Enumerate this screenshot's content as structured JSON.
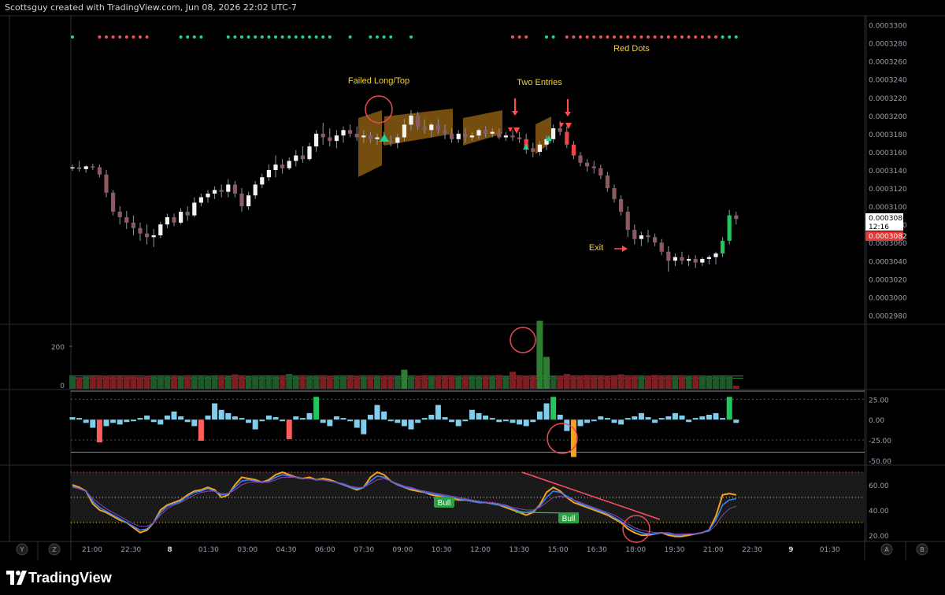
{
  "header": {
    "caption": "Scottsguy created with TradingView.com, Jun 08, 2026 22:02 UTC-7"
  },
  "footer": {
    "brand": "TradingView"
  },
  "annotations": {
    "failed_long": "Failed Long/Top",
    "two_entries": "Two Entries",
    "red_dots": "Red Dots",
    "exit": "Exit",
    "bull1": "Bull",
    "bull2": "Bull"
  },
  "price_scale": {
    "ticks": [
      "0.0003300",
      "0.0003280",
      "0.0003260",
      "0.0003240",
      "0.0003220",
      "0.0003200",
      "0.0003180",
      "0.0003160",
      "0.0003140",
      "0.0003120",
      "0.0003100",
      "0.0003080",
      "0.0003060",
      "0.0003040",
      "0.0003020",
      "0.0003000",
      "0.0002980"
    ],
    "last_price": "0.0003086",
    "countdown": "12:16",
    "other_price": "0.0003082"
  },
  "volume_scale": [
    "200",
    "0"
  ],
  "osc_scale": [
    "25.00",
    "0.00",
    "-25.00",
    "-50.00"
  ],
  "rsi_scale": [
    "60.00",
    "40.00",
    "20.00"
  ],
  "time_axis": [
    "21:00",
    "22:30",
    "8",
    "01:30",
    "03:00",
    "04:30",
    "06:00",
    "07:30",
    "09:00",
    "10:30",
    "12:00",
    "13:30",
    "15:00",
    "16:30",
    "18:00",
    "19:30",
    "21:00",
    "22:30",
    "9",
    "01:30"
  ],
  "axis_buttons": {
    "y": "Y",
    "z": "Z",
    "a1": "A",
    "b": "B",
    "a2": "A"
  },
  "colors": {
    "bull": "#22c55e",
    "bear": "#ef4444",
    "white": "#f4f4f4",
    "dull_red": "#8c5a60",
    "teal": "#26a69a",
    "signal_green": "#1ed39a",
    "signal_red": "#f0505a",
    "annotation": "#f6d232",
    "orange_zone": "#8a5a12",
    "hist_blue": "#80cdec",
    "vol_red": "#7d1e22",
    "vol_green": "#1f5a2a",
    "rsi_orange": "#f7a21b",
    "rsi_blue": "#3b82f6",
    "rsi_purple": "#8e44ad"
  },
  "chart_data": [
    {
      "type": "candlestick",
      "title": "",
      "ylim": [
        0.000297,
        0.000331
      ],
      "x_start": "Jun 07 20:00",
      "note_candles": "approximate OHLC read from the image",
      "candles": [
        [
          0.0003142,
          0.0003146,
          0.0003139,
          0.0003143
        ],
        [
          0.0003143,
          0.000315,
          0.0003138,
          0.0003141
        ],
        [
          0.0003141,
          0.0003145,
          0.0003137,
          0.0003144
        ],
        [
          0.0003144,
          0.0003147,
          0.000314,
          0.0003143
        ],
        [
          0.0003143,
          0.0003146,
          0.0003132,
          0.0003135
        ],
        [
          0.0003135,
          0.000314,
          0.000311,
          0.0003115
        ],
        [
          0.0003115,
          0.0003118,
          0.000309,
          0.0003094
        ],
        [
          0.0003094,
          0.00031,
          0.000308,
          0.0003088
        ],
        [
          0.0003088,
          0.0003095,
          0.0003075,
          0.0003082
        ],
        [
          0.0003082,
          0.000309,
          0.0003068,
          0.0003076
        ],
        [
          0.0003076,
          0.0003082,
          0.0003062,
          0.000307
        ],
        [
          0.000307,
          0.000308,
          0.0003058,
          0.0003066
        ],
        [
          0.0003066,
          0.0003075,
          0.0003055,
          0.0003068
        ],
        [
          0.0003068,
          0.0003083,
          0.0003065,
          0.000308
        ],
        [
          0.000308,
          0.0003092,
          0.0003076,
          0.0003088
        ],
        [
          0.0003088,
          0.0003092,
          0.0003078,
          0.0003082
        ],
        [
          0.0003082,
          0.0003098,
          0.000308,
          0.0003094
        ],
        [
          0.0003094,
          0.00031,
          0.0003084,
          0.000309
        ],
        [
          0.000309,
          0.000311,
          0.0003088,
          0.0003104
        ],
        [
          0.0003104,
          0.0003114,
          0.00031,
          0.000311
        ],
        [
          0.000311,
          0.0003118,
          0.0003104,
          0.0003114
        ],
        [
          0.0003114,
          0.0003122,
          0.0003108,
          0.0003118
        ],
        [
          0.0003118,
          0.0003124,
          0.000311,
          0.0003116
        ],
        [
          0.0003116,
          0.000313,
          0.000311,
          0.0003124
        ],
        [
          0.0003124,
          0.0003128,
          0.000311,
          0.0003114
        ],
        [
          0.0003114,
          0.000312,
          0.0003094,
          0.00031
        ],
        [
          0.00031,
          0.0003116,
          0.0003096,
          0.0003112
        ],
        [
          0.0003112,
          0.0003128,
          0.0003108,
          0.0003124
        ],
        [
          0.0003124,
          0.0003136,
          0.000312,
          0.0003132
        ],
        [
          0.0003132,
          0.0003146,
          0.0003128,
          0.000314
        ],
        [
          0.000314,
          0.0003156,
          0.0003132,
          0.0003146
        ],
        [
          0.0003146,
          0.0003152,
          0.0003136,
          0.0003142
        ],
        [
          0.0003142,
          0.0003154,
          0.000314,
          0.000315
        ],
        [
          0.000315,
          0.0003162,
          0.0003144,
          0.0003156
        ],
        [
          0.0003156,
          0.0003166,
          0.0003148,
          0.0003152
        ],
        [
          0.0003152,
          0.000317,
          0.000315,
          0.0003166
        ],
        [
          0.0003166,
          0.0003184,
          0.000316,
          0.000318
        ],
        [
          0.000318,
          0.0003192,
          0.0003168,
          0.0003176
        ],
        [
          0.0003176,
          0.0003186,
          0.0003166,
          0.0003172
        ],
        [
          0.0003172,
          0.0003184,
          0.0003164,
          0.0003178
        ],
        [
          0.0003178,
          0.0003188,
          0.000317,
          0.0003184
        ],
        [
          0.0003184,
          0.000319,
          0.0003176,
          0.000318
        ],
        [
          0.000318,
          0.0003188,
          0.0003172,
          0.0003176
        ],
        [
          0.0003176,
          0.0003184,
          0.000317,
          0.0003178
        ],
        [
          0.0003178,
          0.0003182,
          0.000317,
          0.0003174
        ],
        [
          0.0003174,
          0.000318,
          0.0003168,
          0.0003176
        ],
        [
          0.0003176,
          0.0003182,
          0.0003168,
          0.0003172
        ],
        [
          0.0003172,
          0.0003178,
          0.0003166,
          0.000317
        ],
        [
          0.000317,
          0.000318,
          0.0003164,
          0.0003176
        ],
        [
          0.0003176,
          0.0003196,
          0.0003172,
          0.000319
        ],
        [
          0.000319,
          0.0003206,
          0.0003184,
          0.00032
        ],
        [
          0.00032,
          0.0003204,
          0.0003184,
          0.0003188
        ],
        [
          0.0003188,
          0.0003196,
          0.000318,
          0.0003184
        ],
        [
          0.0003184,
          0.0003192,
          0.0003176,
          0.000319
        ],
        [
          0.000319,
          0.0003196,
          0.000318,
          0.0003184
        ],
        [
          0.0003184,
          0.000319,
          0.0003174,
          0.000318
        ],
        [
          0.000318,
          0.0003186,
          0.000317,
          0.0003174
        ],
        [
          0.0003174,
          0.0003184,
          0.000317,
          0.000318
        ],
        [
          0.000318,
          0.0003186,
          0.000317,
          0.0003176
        ],
        [
          0.0003176,
          0.0003182,
          0.0003172,
          0.0003178
        ],
        [
          0.0003178,
          0.0003186,
          0.0003174,
          0.0003184
        ],
        [
          0.0003184,
          0.0003188,
          0.0003176,
          0.000318
        ],
        [
          0.000318,
          0.0003186,
          0.0003176,
          0.0003182
        ],
        [
          0.0003182,
          0.0003186,
          0.0003174,
          0.0003176
        ],
        [
          0.0003176,
          0.0003182,
          0.0003172,
          0.0003178
        ],
        [
          0.0003178,
          0.0003184,
          0.0003172,
          0.0003176
        ],
        [
          0.0003176,
          0.0003182,
          0.000317,
          0.0003174
        ],
        [
          0.0003174,
          0.000318,
          0.0003158,
          0.0003164
        ],
        [
          0.0003164,
          0.000317,
          0.0003154,
          0.000316
        ],
        [
          0.000316,
          0.0003172,
          0.0003156,
          0.0003168
        ],
        [
          0.0003168,
          0.0003178,
          0.0003162,
          0.0003174
        ],
        [
          0.0003174,
          0.000319,
          0.000317,
          0.0003186
        ],
        [
          0.0003186,
          0.0003194,
          0.0003178,
          0.0003182
        ],
        [
          0.0003182,
          0.0003188,
          0.0003164,
          0.0003168
        ],
        [
          0.0003168,
          0.0003172,
          0.0003152,
          0.0003156
        ],
        [
          0.0003156,
          0.000316,
          0.0003144,
          0.0003148
        ],
        [
          0.0003148,
          0.0003152,
          0.0003138,
          0.0003144
        ],
        [
          0.0003144,
          0.000315,
          0.0003136,
          0.0003142
        ],
        [
          0.0003142,
          0.0003146,
          0.000313,
          0.0003134
        ],
        [
          0.0003134,
          0.0003138,
          0.0003116,
          0.000312
        ],
        [
          0.000312,
          0.0003124,
          0.0003104,
          0.0003108
        ],
        [
          0.0003108,
          0.0003112,
          0.000309,
          0.0003094
        ],
        [
          0.0003094,
          0.00031,
          0.0003066,
          0.0003074
        ],
        [
          0.0003074,
          0.000308,
          0.0003058,
          0.0003064
        ],
        [
          0.0003064,
          0.0003072,
          0.0003056,
          0.0003068
        ],
        [
          0.0003068,
          0.0003074,
          0.000306,
          0.0003066
        ],
        [
          0.0003066,
          0.000307,
          0.0003056,
          0.000306
        ],
        [
          0.000306,
          0.0003064,
          0.0003046,
          0.000305
        ],
        [
          0.000305,
          0.0003056,
          0.0003028,
          0.000304
        ],
        [
          0.000304,
          0.0003048,
          0.0003034,
          0.0003044
        ],
        [
          0.0003044,
          0.000305,
          0.0003036,
          0.000304
        ],
        [
          0.000304,
          0.0003046,
          0.0003034,
          0.0003042
        ],
        [
          0.0003042,
          0.0003046,
          0.0003032,
          0.0003038
        ],
        [
          0.0003038,
          0.0003044,
          0.0003034,
          0.0003042
        ],
        [
          0.0003042,
          0.0003046,
          0.0003036,
          0.0003044
        ],
        [
          0.0003044,
          0.000305,
          0.0003036,
          0.0003048
        ],
        [
          0.0003048,
          0.0003066,
          0.0003044,
          0.0003062
        ],
        [
          0.0003062,
          0.0003096,
          0.0003058,
          0.000309
        ],
        [
          0.000309,
          0.0003094,
          0.000308,
          0.0003086
        ]
      ]
    },
    {
      "type": "bar",
      "title": "",
      "ylim": [
        0,
        300
      ],
      "note": "volume, approximate",
      "values": [
        60,
        55,
        60,
        58,
        60,
        62,
        60,
        58,
        60,
        60,
        56,
        62,
        60,
        58,
        60,
        60,
        62,
        60,
        60,
        58,
        62,
        64,
        60,
        60,
        68,
        60,
        62,
        60,
        60,
        58,
        62,
        60,
        70,
        60,
        60,
        62,
        60,
        60,
        62,
        60,
        60,
        58,
        62,
        60,
        60,
        60,
        62,
        60,
        60,
        90,
        60,
        62,
        64,
        60,
        60,
        58,
        60,
        62,
        60,
        60,
        62,
        60,
        60,
        65,
        62,
        80,
        60,
        62,
        60,
        320,
        150,
        60,
        62,
        70,
        60,
        60,
        65,
        58,
        60,
        62,
        60,
        68,
        60,
        60,
        60,
        62,
        65,
        60,
        60,
        58,
        60,
        62,
        60,
        60,
        62,
        60,
        58,
        62,
        15
      ]
    },
    {
      "type": "bar",
      "title": "",
      "ylim": [
        -55,
        35
      ],
      "note": "oscillator histogram, approximate",
      "values": [
        3,
        2,
        -4,
        -10,
        -28,
        -8,
        -4,
        -6,
        -3,
        -2,
        2,
        5,
        -3,
        -6,
        5,
        10,
        4,
        -3,
        -8,
        -26,
        5,
        20,
        12,
        8,
        4,
        2,
        -4,
        -12,
        -2,
        5,
        3,
        -2,
        -24,
        4,
        2,
        8,
        28,
        -4,
        -8,
        4,
        2,
        -2,
        -10,
        -18,
        6,
        18,
        10,
        -2,
        -4,
        -8,
        -12,
        -4,
        2,
        6,
        18,
        3,
        -3,
        -8,
        -2,
        12,
        8,
        5,
        2,
        -3,
        -2,
        -4,
        -6,
        -8,
        -3,
        10,
        20,
        28,
        6,
        -14,
        -46,
        -8,
        -4,
        -2,
        4,
        2,
        -4,
        -6,
        2,
        4,
        8,
        3,
        -4,
        2,
        4,
        8,
        5,
        -3,
        2,
        4,
        6,
        8,
        2,
        28,
        -4
      ]
    },
    {
      "type": "line",
      "title": "",
      "ylim": [
        15,
        75
      ],
      "note": "RSI-style oscillator, approximate",
      "series": [
        {
          "values": [
            60,
            58,
            55,
            45,
            40,
            38,
            35,
            32,
            30,
            26,
            22,
            24,
            30,
            40,
            44,
            46,
            48,
            52,
            55,
            56,
            58,
            56,
            50,
            52,
            60,
            66,
            65,
            64,
            62,
            64,
            68,
            70,
            68,
            66,
            65,
            66,
            64,
            65,
            64,
            62,
            60,
            58,
            56,
            58,
            66,
            70,
            68,
            63,
            60,
            58,
            56,
            55,
            54,
            52,
            51,
            50,
            49,
            48,
            48,
            47,
            46,
            46,
            45,
            44,
            42,
            40,
            38,
            36,
            38,
            44,
            54,
            58,
            55,
            50,
            46,
            44,
            42,
            40,
            38,
            36,
            33,
            30,
            25,
            22,
            20,
            20,
            21,
            22,
            20,
            19,
            19,
            20,
            21,
            22,
            24,
            35,
            52,
            53,
            52
          ]
        },
        {
          "values": [
            59,
            57,
            55,
            47,
            42,
            39,
            36,
            33,
            30,
            27,
            24,
            25,
            30,
            38,
            43,
            45,
            47,
            51,
            54,
            55,
            57,
            55,
            52,
            53,
            58,
            63,
            64,
            63,
            62,
            63,
            66,
            68,
            67,
            66,
            65,
            65,
            64,
            64,
            63,
            62,
            60,
            58,
            57,
            58,
            63,
            67,
            66,
            63,
            60,
            58,
            57,
            56,
            54,
            53,
            52,
            51,
            50,
            49,
            48,
            47,
            46,
            46,
            45,
            44,
            43,
            41,
            39,
            38,
            39,
            43,
            50,
            55,
            54,
            51,
            48,
            45,
            43,
            41,
            39,
            37,
            34,
            31,
            27,
            24,
            22,
            21,
            21,
            22,
            21,
            20,
            20,
            21,
            21,
            22,
            24,
            32,
            44,
            48,
            49
          ]
        },
        {
          "values": [
            58,
            57,
            55,
            49,
            45,
            41,
            38,
            35,
            32,
            29,
            27,
            27,
            30,
            36,
            41,
            44,
            46,
            49,
            52,
            54,
            55,
            55,
            53,
            53,
            56,
            60,
            62,
            62,
            62,
            62,
            64,
            66,
            66,
            66,
            65,
            65,
            64,
            64,
            63,
            62,
            61,
            59,
            58,
            58,
            61,
            64,
            65,
            63,
            61,
            59,
            58,
            56,
            55,
            54,
            53,
            52,
            51,
            50,
            49,
            48,
            47,
            46,
            46,
            45,
            44,
            42,
            41,
            40,
            40,
            42,
            46,
            50,
            51,
            50,
            48,
            46,
            44,
            42,
            40,
            38,
            36,
            33,
            29,
            26,
            24,
            23,
            22,
            22,
            22,
            21,
            21,
            21,
            21,
            22,
            23,
            28,
            36,
            41,
            43
          ]
        }
      ]
    }
  ]
}
